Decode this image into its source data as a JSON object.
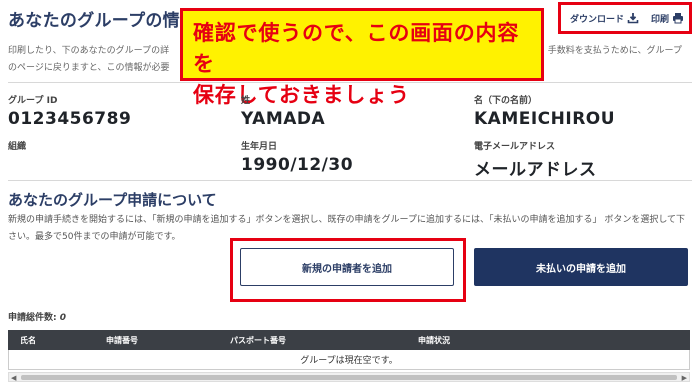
{
  "header": {
    "title": "あなたのグループの情報",
    "download_label": "ダウンロード",
    "print_label": "印刷"
  },
  "callout": {
    "line1": "確認で使うので、この画面の内容を",
    "line2": "保存しておきましょう"
  },
  "intro": {
    "line1_left": "印刷したり、下のあなたのグループの詳",
    "line1_right": "手数料を支払うために、グループ",
    "line2_left": "のページに戻りますと、この情報が必要"
  },
  "group_info": {
    "group_id_label": "グループ ID",
    "group_id_value": "0123456789",
    "surname_label": "姓",
    "surname_value": "YAMADA",
    "given_name_label": "名（下の名前）",
    "given_name_value": "KAMEICHIROU",
    "organization_label": "組織",
    "organization_value": "",
    "dob_label": "生年月日",
    "dob_value": "1990/12/30",
    "email_label": "電子メールアドレス",
    "email_value": "メールアドレス"
  },
  "applications": {
    "title": "あなたのグループ申請について",
    "description": "新規の申請手続きを開始するには、「新規の申請を追加する」ボタンを選択し、既存の申請をグループに追加するには、「未払いの申請を追加する」 ボタンを選択して下さい。最多で50件までの申請が可能です。",
    "add_new_button": "新規の申請者を追加",
    "add_unpaid_button": "未払いの申請を追加",
    "count_label": "申請総件数:",
    "count_value": "0"
  },
  "table": {
    "columns": [
      "氏名",
      "申請番号",
      "パスポート番号",
      "申請状況"
    ],
    "empty_message": "グループは現在空です。"
  },
  "colors": {
    "accent_navy": "#1f3461",
    "highlight_red": "#e60012",
    "callout_yellow": "#fff200"
  }
}
